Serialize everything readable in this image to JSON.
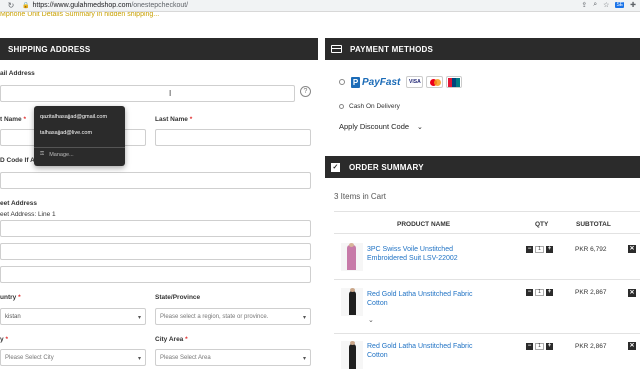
{
  "browser": {
    "url_host": "https://www.gulahmedshop.com",
    "url_path": "/onestepcheckout/"
  },
  "notice": "Mphone Unit Details Summary in hidden shipping...",
  "shipping": {
    "title": "SHIPPING ADDRESS",
    "email_label": "ail Address",
    "first_name_label": "t Name",
    "last_name_label": "Last Name",
    "cnic_label": "D Code If Ap",
    "street_label": "eet Address",
    "street_line1_label": "eet Address: Line 1",
    "country_label": "untry",
    "country_value": "kistan",
    "state_label": "State/Province",
    "state_placeholder": "Please select a region, state or province.",
    "city_label": "y",
    "city_placeholder": "Please Select City",
    "city_area_label": "City Area",
    "city_area_placeholder": "Please Select Area",
    "required_mark": "*"
  },
  "autocomplete": {
    "options": [
      "qazitalhasajjad@gmail.com",
      "talhasajjad@live.com"
    ],
    "manage_label": "Manage..."
  },
  "payment": {
    "title": "PAYMENT METHODS",
    "payfast_label": "PayFast",
    "visa_label": "VISA",
    "cod_label": "Cash On Delivery",
    "discount_label": "Apply Discount Code"
  },
  "order_summary": {
    "title": "ORDER SUMMARY",
    "items_in_cart": "3 Items in Cart",
    "col_product": "PRODUCT NAME",
    "col_qty": "QTY",
    "col_subtotal": "SUBTOTAL",
    "items": [
      {
        "name_line1": "3PC Swiss Voile Unstitched",
        "name_line2": "Embroidered Suit LSV-22002",
        "qty": "1",
        "subtotal": "PKR 6,792"
      },
      {
        "name_line1": "Red Gold Latha Unstitched Fabric",
        "name_line2": "Cotton",
        "qty": "1",
        "subtotal": "PKR 2,867"
      },
      {
        "name_line1": "Red Gold Latha Unstitched Fabric",
        "name_line2": "Cotton",
        "qty": "1",
        "subtotal": "PKR 2,867"
      }
    ]
  },
  "colors": {
    "header_bg": "#2b2b2b",
    "link_blue": "#1f72c4",
    "required_red": "#e02b2b"
  }
}
